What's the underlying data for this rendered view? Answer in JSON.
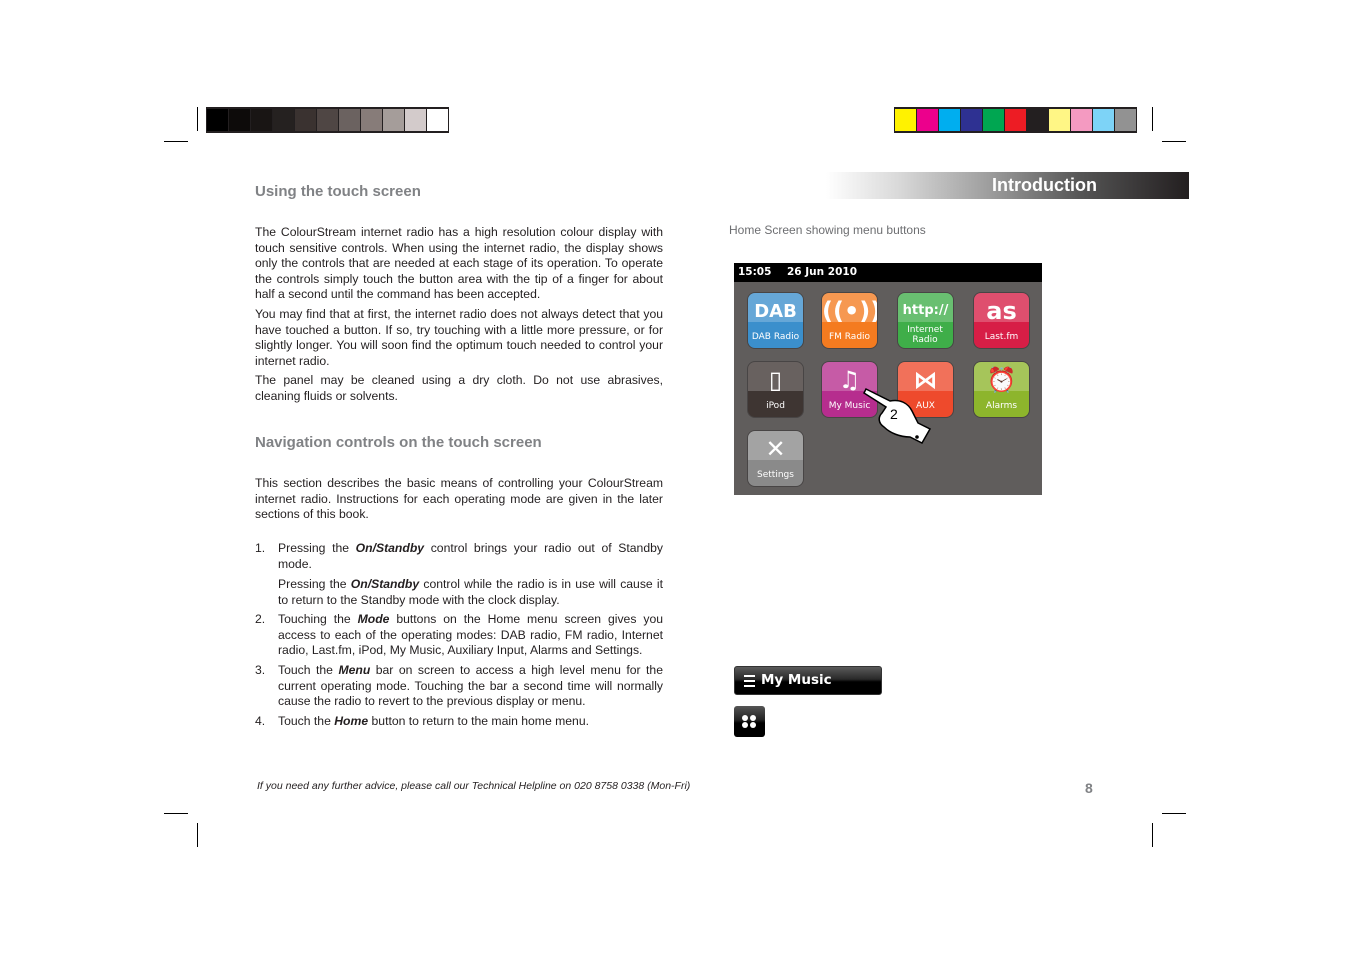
{
  "print_marks": {
    "grayscale_bar": [
      "#000000",
      "#0d0b0a",
      "#191514",
      "#252120",
      "#3a3230",
      "#4f4644",
      "#6b6260",
      "#877c79",
      "#a59d9a",
      "#d3cbcb",
      "#ffffff"
    ],
    "colour_bar": [
      "#fff200",
      "#ec008c",
      "#00aeef",
      "#2e3192",
      "#00a651",
      "#ed1c24",
      "#231f20",
      "#fff685",
      "#f49ac1",
      "#7dd3f7",
      "#929292"
    ]
  },
  "section_banner": "Introduction",
  "left_column": {
    "heading1": "Using the touch screen",
    "para1": "The ColourStream internet radio has a high resolution colour display with touch sensitive controls. When using the internet radio, the display shows only the controls that are needed at each stage of its operation. To operate the controls simply touch the button area with the tip of a finger for about half a second until the command has been accepted.",
    "para2": "You may find that at first, the internet radio does not always detect that you have touched a button. If so, try touching with a little more pressure, or for slightly longer. You will soon find the optimum touch needed to control your internet radio.",
    "para3": "The panel may be cleaned using a dry cloth. Do not use abrasives, cleaning fluids or solvents.",
    "heading2": "Navigation controls on the touch screen",
    "para4": "This section describes the basic means of controlling your ColourStream internet radio. Instructions for each operating mode are given in the later sections of this book.",
    "list": [
      {
        "num": "1.",
        "pre": "Pressing the ",
        "em": "On/Standby",
        "post": " control brings your radio out of Standby mode."
      },
      {
        "num": "",
        "pre": "Pressing the ",
        "em": "On/Standby",
        "post": " control while the radio is in use will cause it to return to the Standby mode with the clock display."
      },
      {
        "num": "2.",
        "pre": "Touching the ",
        "em": "Mode",
        "post": " buttons on the Home menu screen gives you access to each of the operating modes: DAB radio, FM radio, Internet radio, Last.fm, iPod, My Music, Auxiliary Input, Alarms and Settings."
      },
      {
        "num": "3.",
        "pre": "Touch the ",
        "em": "Menu",
        "post": " bar on screen to access a high level menu for the current operating mode. Touching the bar a second time will normally cause the radio to revert to the previous display or menu."
      },
      {
        "num": "4.",
        "pre": "Touch the ",
        "em": "Home",
        "post": " button to return to the main home menu."
      }
    ]
  },
  "right_column": {
    "caption": "Home Screen showing menu buttons",
    "screen": {
      "time": "15:05",
      "date": "26 Jun 2010",
      "tiles": [
        {
          "label": "DAB Radio",
          "glyph": "DAB",
          "color": "#3b8fcc",
          "icon": "dab-icon"
        },
        {
          "label": "FM Radio",
          "glyph": "((•))",
          "color": "#f47b20",
          "icon": "fm-antenna-icon"
        },
        {
          "label": "Internet Radio",
          "glyph": "http://",
          "color": "#3fae49",
          "icon": "http-icon"
        },
        {
          "label": "Last.fm",
          "glyph": "as",
          "color": "#d71e46",
          "icon": "lastfm-icon"
        },
        {
          "label": "iPod",
          "glyph": "▯",
          "color": "#3e3532",
          "icon": "ipod-icon"
        },
        {
          "label": "My Music",
          "glyph": "♫",
          "color": "#b62d8e",
          "icon": "music-note-icon"
        },
        {
          "label": "AUX",
          "glyph": "⋈",
          "color": "#ee4a2c",
          "icon": "aux-icon"
        },
        {
          "label": "Alarms",
          "glyph": "⏰",
          "color": "#8db52c",
          "icon": "alarm-clock-icon"
        },
        {
          "label": "Settings",
          "glyph": "✕",
          "color": "#8a8a8a",
          "icon": "wrench-icon"
        }
      ],
      "pointer_step": "2"
    },
    "menu_bar_label": "My Music"
  },
  "footer": {
    "helpline": "If you need any further advice, please call our Technical Helpline on 020 8758 0338 (Mon-Fri)",
    "page_number": "8"
  }
}
